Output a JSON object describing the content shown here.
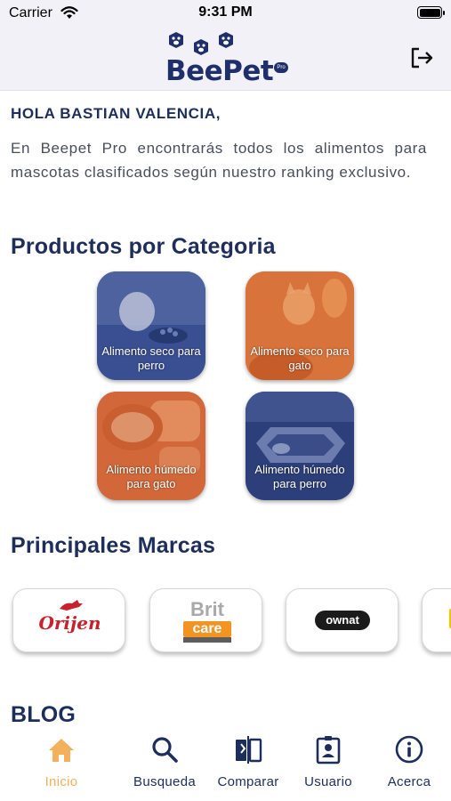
{
  "status_bar": {
    "carrier": "Carrier",
    "time": "9:31 PM"
  },
  "header": {
    "logo_text": "BeePet",
    "logo_badge": "Pro",
    "logout_icon": "logout-icon"
  },
  "home": {
    "greeting": "HOLA BASTIAN VALENCIA,",
    "intro": "En Beepet Pro encontrarás todos los alimentos para mascotas clasificados según nuestro ranking exclusivo."
  },
  "categories": {
    "title": "Productos por Categoria",
    "items": [
      {
        "label": "Alimento seco para perro",
        "color": "#3a4f92"
      },
      {
        "label": "Alimento seco para gato",
        "color": "#d9733c"
      },
      {
        "label": "Alimento húmedo para gato",
        "color": "#d2683a"
      },
      {
        "label": "Alimento húmedo para perro",
        "color": "#2d3f7a"
      }
    ]
  },
  "brands": {
    "title": "Principales Marcas",
    "items": [
      {
        "name": "Orijen",
        "logo_text": "Orijen"
      },
      {
        "name": "Brit Care",
        "logo_text_1": "Brit",
        "logo_text_2": "care"
      },
      {
        "name": "Ownat",
        "logo_text": "ownat"
      },
      {
        "name": "partial-brand"
      }
    ]
  },
  "blog": {
    "title": "BLOG"
  },
  "tab_bar": {
    "items": [
      {
        "label": "Inicio",
        "icon": "home-icon",
        "active": true
      },
      {
        "label": "Busqueda",
        "icon": "search-icon",
        "active": false
      },
      {
        "label": "Comparar",
        "icon": "compare-icon",
        "active": false
      },
      {
        "label": "Usuario",
        "icon": "user-badge-icon",
        "active": false
      },
      {
        "label": "Acerca",
        "icon": "info-icon",
        "active": false
      }
    ],
    "active_color": "#f2b15a",
    "inactive_color": "#1e2e5c"
  }
}
